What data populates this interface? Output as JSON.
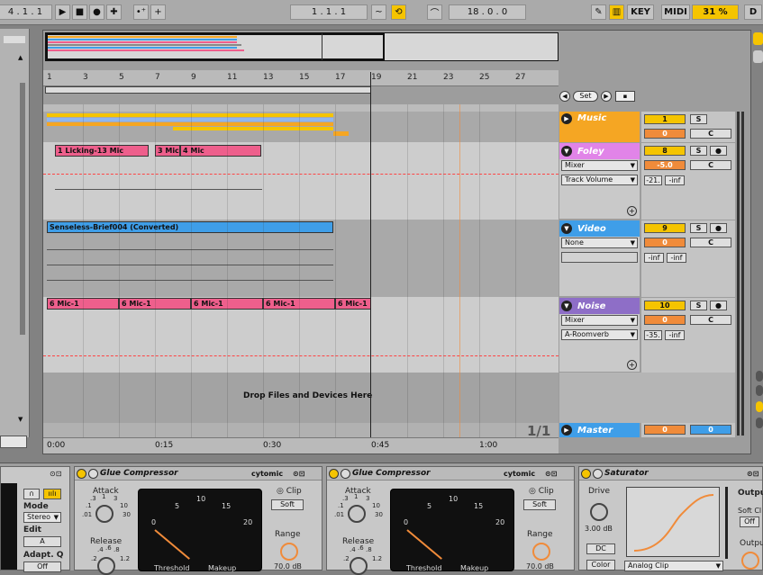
{
  "transport": {
    "position": "4 .  1 .  1",
    "play_icon": "play-icon",
    "stop_icon": "stop-icon",
    "record_icon": "record-icon",
    "loop_start": "1 .  1 .  1",
    "loop_length": "18 .  0 .  0",
    "key_label": "KEY",
    "midi_label": "MIDI",
    "cpu": "31 %",
    "disk": "D"
  },
  "ruler": {
    "bars": [
      "1",
      "3",
      "5",
      "7",
      "9",
      "11",
      "13",
      "15",
      "17",
      "19",
      "21",
      "23",
      "25",
      "27"
    ],
    "times": [
      "0:00",
      "0:15",
      "0:30",
      "0:45",
      "1:00"
    ]
  },
  "set_button": "Set",
  "tracks": {
    "music": {
      "name": "Music",
      "number": "1",
      "solo": "S",
      "vol": "0",
      "pan": "C"
    },
    "foley": {
      "name": "Foley",
      "number": "8",
      "solo": "S",
      "vol": "-5.0",
      "pan": "C",
      "device": "Mixer",
      "param": "Track Volume",
      "val1": "-21.",
      "val2": "-inf"
    },
    "video": {
      "name": "Video",
      "number": "9",
      "solo": "S",
      "vol": "0",
      "pan": "C",
      "device": "None",
      "val1": "-inf",
      "val2": "-inf"
    },
    "noise": {
      "name": "Noise",
      "number": "10",
      "solo": "S",
      "vol": "0",
      "pan": "C",
      "device": "Mixer",
      "param": "A-Roomverb",
      "val1": "-35.",
      "val2": "-inf"
    },
    "master": {
      "name": "Master",
      "vol": "0",
      "vol2": "0",
      "fraction": "1/1"
    }
  },
  "clips": {
    "foley": [
      "1 Licking-13 Mic",
      "3 Mic",
      "4 Mic"
    ],
    "video": "Senseless-Brief004 (Converted)",
    "noise": [
      "6 Mic-1",
      "6 Mic-1",
      "6 Mic-1",
      "6 Mic-1",
      "6 Mic-1"
    ]
  },
  "drop_text": "Drop Files and Devices Here",
  "devices": {
    "left": {
      "mode_label": "Mode",
      "mode_value": "Stereo",
      "edit_label": "Edit",
      "edit_value": "A",
      "adapt_label": "Adapt. Q",
      "adapt_value": "Off"
    },
    "glue1": {
      "title": "Glue Compressor",
      "brand": "cytomic",
      "attack": "Attack",
      "release": "Release",
      "clip": "Clip",
      "soft": "Soft",
      "range": "Range",
      "range_value": "70.0 dB",
      "threshold": "Threshold",
      "makeup": "Makeup",
      "attack_ticks": [
        ".3",
        "1",
        "3",
        ".1",
        "10",
        ".01",
        "30"
      ],
      "release_ticks": [
        ".4",
        ".6",
        ".8",
        ".2",
        "1.2"
      ],
      "meter_ticks": [
        "0",
        "5",
        "10",
        "15",
        "20"
      ]
    },
    "glue2": {
      "title": "Glue Compressor",
      "brand": "cytomic",
      "attack": "Attack",
      "release": "Release",
      "clip": "Clip",
      "soft": "Soft",
      "range": "Range",
      "range_value": "70.0 dB",
      "threshold": "Threshold",
      "makeup": "Makeup",
      "attack_ticks": [
        ".3",
        "1",
        "3",
        ".1",
        "10",
        ".01",
        "30"
      ],
      "release_ticks": [
        ".4",
        ".6",
        ".8",
        ".2",
        "1.2"
      ],
      "meter_ticks": [
        "0",
        "5",
        "10",
        "15",
        "20"
      ]
    },
    "saturator": {
      "title": "Saturator",
      "drive": "Drive",
      "drive_value": "3.00 dB",
      "dc": "DC",
      "color": "Color",
      "mode": "Analog Clip",
      "output": "Output",
      "soft_clip": "Soft Cl",
      "soft_clip_value": "Off",
      "output2": "Outpu"
    }
  },
  "colors": {
    "music": "#f5a623",
    "foley": "#e184e8",
    "video": "#3f9ee8",
    "noise": "#8e6ec7",
    "master": "#3f9ee8",
    "accent": "#f5c400"
  }
}
